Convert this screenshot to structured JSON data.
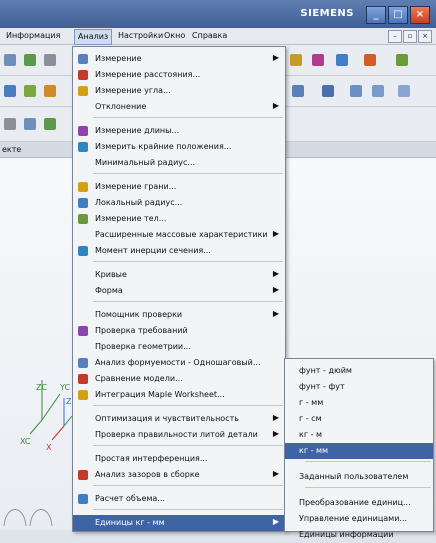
{
  "brand": "SIEMENS",
  "menubar": {
    "items": [
      "Информация",
      "Анализ",
      "Настройки",
      "Окно",
      "Справка"
    ],
    "active_index": 1
  },
  "panel_label": "екте",
  "analysis_menu": [
    {
      "label": "Измерение",
      "icon": "measure-icon",
      "arrow": true
    },
    {
      "label": "Измерение расстояния...",
      "icon": "distance-icon"
    },
    {
      "label": "Измерение угла...",
      "icon": "angle-icon"
    },
    {
      "label": "Отклонение",
      "arrow": true
    },
    {
      "separator": true
    },
    {
      "label": "Измерение длины...",
      "icon": "length-icon"
    },
    {
      "label": "Измерить крайние положения...",
      "icon": "extreme-icon"
    },
    {
      "label": "Минимальный радиус..."
    },
    {
      "separator": true
    },
    {
      "label": "Измерение грани...",
      "icon": "face-icon"
    },
    {
      "label": "Локальный радиус...",
      "icon": "radius-icon"
    },
    {
      "label": "Измерение тел...",
      "icon": "body-icon"
    },
    {
      "label": "Расширенные массовые характеристики",
      "arrow": true
    },
    {
      "label": "Момент инерции сечения...",
      "icon": "inertia-icon"
    },
    {
      "separator": true
    },
    {
      "label": "Кривые",
      "arrow": true
    },
    {
      "label": "Форма",
      "arrow": true
    },
    {
      "separator": true
    },
    {
      "label": "Помощник проверки",
      "arrow": true
    },
    {
      "label": "Проверка требований",
      "icon": "requirements-icon"
    },
    {
      "label": "Проверка геометрии..."
    },
    {
      "label": "Анализ формуемости - Одношаговый...",
      "icon": "formability-icon"
    },
    {
      "label": "Сравнение модели...",
      "icon": "compare-icon"
    },
    {
      "label": "Интеграция Maple Worksheet...",
      "icon": "maple-icon"
    },
    {
      "separator": true
    },
    {
      "label": "Оптимизация и чувствительность",
      "arrow": true
    },
    {
      "label": "Проверка правильности литой детали",
      "arrow": true
    },
    {
      "separator": true
    },
    {
      "label": "Простая интерференция..."
    },
    {
      "label": "Анализ зазоров в сборке",
      "icon": "clearance-icon",
      "arrow": true
    },
    {
      "separator": true
    },
    {
      "label": "Расчет объема...",
      "icon": "volume-icon"
    },
    {
      "separator": true
    },
    {
      "label": "Единицы кг - мм",
      "arrow": true,
      "highlighted": true
    }
  ],
  "units_submenu": [
    {
      "label": "фунт - дюйм"
    },
    {
      "label": "фунт - фут"
    },
    {
      "label": "г - мм"
    },
    {
      "label": "г - см"
    },
    {
      "label": "кг - м"
    },
    {
      "label": "кг - мм",
      "highlighted": true
    },
    {
      "separator": true
    },
    {
      "label": "Заданный пользователем"
    },
    {
      "separator": true
    },
    {
      "label": "Преобразование единиц..."
    },
    {
      "label": "Управление единицами..."
    },
    {
      "label": "Единицы информации"
    }
  ],
  "triad": {
    "zc": "ZC",
    "yc": "YC",
    "xc": "XC",
    "z": "Z",
    "y": "Y",
    "x": "X"
  },
  "colors": {
    "highlight": "#3f64a6",
    "menu_bg": "#f3f4f6",
    "title_bar": "#4a6aa3"
  }
}
